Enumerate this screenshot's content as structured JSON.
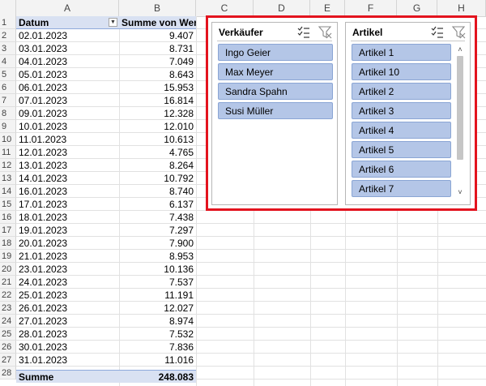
{
  "columns": [
    "A",
    "B",
    "C",
    "D",
    "E",
    "F",
    "G",
    "H"
  ],
  "rows": [
    "1",
    "2",
    "3",
    "4",
    "5",
    "6",
    "7",
    "8",
    "9",
    "10",
    "11",
    "12",
    "13",
    "14",
    "15",
    "16",
    "17",
    "18",
    "19",
    "20",
    "21",
    "22",
    "23",
    "24",
    "25",
    "26",
    "27",
    "28"
  ],
  "pivot": {
    "header_date": "Datum",
    "header_sum": "Summe von Wert",
    "records": [
      {
        "date": "02.01.2023",
        "value": "9.407"
      },
      {
        "date": "03.01.2023",
        "value": "8.731"
      },
      {
        "date": "04.01.2023",
        "value": "7.049"
      },
      {
        "date": "05.01.2023",
        "value": "8.643"
      },
      {
        "date": "06.01.2023",
        "value": "15.953"
      },
      {
        "date": "07.01.2023",
        "value": "16.814"
      },
      {
        "date": "09.01.2023",
        "value": "12.328"
      },
      {
        "date": "10.01.2023",
        "value": "12.010"
      },
      {
        "date": "11.01.2023",
        "value": "10.613"
      },
      {
        "date": "12.01.2023",
        "value": "4.765"
      },
      {
        "date": "13.01.2023",
        "value": "8.264"
      },
      {
        "date": "14.01.2023",
        "value": "10.792"
      },
      {
        "date": "16.01.2023",
        "value": "8.740"
      },
      {
        "date": "17.01.2023",
        "value": "6.137"
      },
      {
        "date": "18.01.2023",
        "value": "7.438"
      },
      {
        "date": "19.01.2023",
        "value": "7.297"
      },
      {
        "date": "20.01.2023",
        "value": "7.900"
      },
      {
        "date": "21.01.2023",
        "value": "8.953"
      },
      {
        "date": "23.01.2023",
        "value": "10.136"
      },
      {
        "date": "24.01.2023",
        "value": "7.537"
      },
      {
        "date": "25.01.2023",
        "value": "11.191"
      },
      {
        "date": "26.01.2023",
        "value": "12.027"
      },
      {
        "date": "27.01.2023",
        "value": "8.974"
      },
      {
        "date": "28.01.2023",
        "value": "7.532"
      },
      {
        "date": "30.01.2023",
        "value": "7.836"
      },
      {
        "date": "31.01.2023",
        "value": "11.016"
      }
    ],
    "total_label": "Summe",
    "total_value": "248.083"
  },
  "slicer_verkaeufer": {
    "title": "Verkäufer",
    "items": [
      "Ingo Geier",
      "Max Meyer",
      "Sandra Spahn",
      "Susi Müller"
    ]
  },
  "slicer_artikel": {
    "title": "Artikel",
    "items": [
      "Artikel 1",
      "Artikel 10",
      "Artikel 2",
      "Artikel 3",
      "Artikel 4",
      "Artikel 5",
      "Artikel 6",
      "Artikel 7"
    ]
  },
  "colors": {
    "highlight_frame": "#e3131e",
    "slicer_item": "#b4c6e7",
    "pivot_header": "#d9e1f2"
  },
  "icons": {
    "multi_select": "multi-select-icon",
    "clear_filter": "clear-filter-icon"
  }
}
